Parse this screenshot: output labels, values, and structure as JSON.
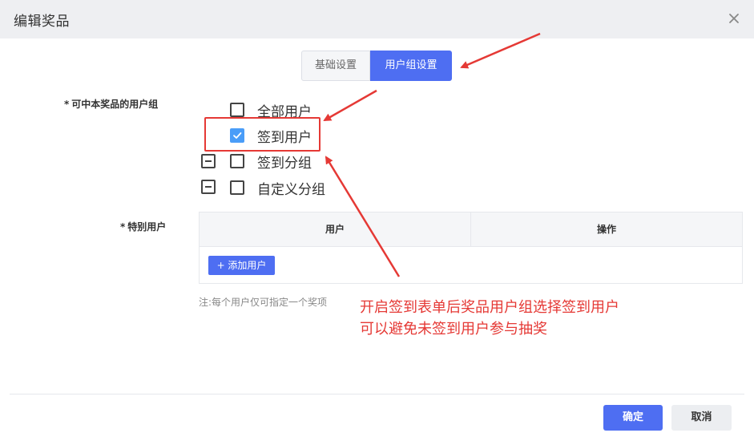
{
  "dialog": {
    "title": "编辑奖品",
    "close_icon": "close-icon"
  },
  "tabs": [
    {
      "label": "基础设置",
      "active": false
    },
    {
      "label": "用户组设置",
      "active": true
    }
  ],
  "user_groups": {
    "label": "可中本奖品的用户组",
    "required_mark": "*",
    "options": [
      {
        "label": "全部用户",
        "checked": false,
        "collapsible": false
      },
      {
        "label": "签到用户",
        "checked": true,
        "collapsible": false
      },
      {
        "label": "签到分组",
        "checked": false,
        "collapsible": true
      },
      {
        "label": "自定义分组",
        "checked": false,
        "collapsible": true
      }
    ]
  },
  "special_users": {
    "label": "特别用户",
    "required_mark": "*",
    "columns": [
      "用户",
      "操作"
    ],
    "add_button": "+ 添加用户",
    "note": "注:每个用户仅可指定一个奖项"
  },
  "annotation": {
    "line1": "开启签到表单后奖品用户组选择签到用户",
    "line2": "可以避免未签到用户参与抽奖",
    "color": "#e53935"
  },
  "footer": {
    "confirm": "确定",
    "cancel": "取消"
  },
  "colors": {
    "primary": "#4e6ef2",
    "checkbox_checked": "#4a9df8",
    "annotation_red": "#e53935",
    "header_bg": "#eeeff2"
  }
}
